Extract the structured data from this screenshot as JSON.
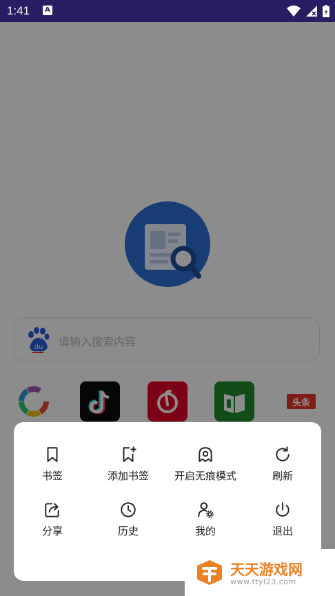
{
  "status_bar": {
    "time": "1:41",
    "notification_icon": "A",
    "icons": [
      "wifi-icon",
      "signal-icon",
      "battery-icon"
    ]
  },
  "app": {
    "logo_icon": "browser-search-logo",
    "search": {
      "placeholder": "请输入搜索内容",
      "engine_icon": "baidu-paw-icon"
    },
    "quick_links": [
      {
        "icon": "colorful-app-icon"
      },
      {
        "icon": "douyin-icon"
      },
      {
        "icon": "netease-music-icon"
      },
      {
        "icon": "reader-book-icon"
      },
      {
        "icon": "toutiao-icon",
        "label": "头条"
      }
    ]
  },
  "menu": {
    "items": [
      {
        "label": "书签",
        "icon": "bookmark-icon"
      },
      {
        "label": "添加书签",
        "icon": "add-bookmark-icon"
      },
      {
        "label": "开启无痕模式",
        "icon": "incognito-icon"
      },
      {
        "label": "刷新",
        "icon": "refresh-icon"
      },
      {
        "label": "分享",
        "icon": "share-icon"
      },
      {
        "label": "历史",
        "icon": "history-icon"
      },
      {
        "label": "我的",
        "icon": "user-settings-icon"
      },
      {
        "label": "退出",
        "icon": "power-icon"
      }
    ]
  },
  "watermark": {
    "title": "天天游戏网",
    "url": "www.ttyl23.com"
  },
  "colors": {
    "status_bar": "#2a1c63",
    "brand_blue": "#2c6fd4",
    "accent_orange": "#ef7f23",
    "overlay": "rgba(0,0,0,0.45)"
  }
}
